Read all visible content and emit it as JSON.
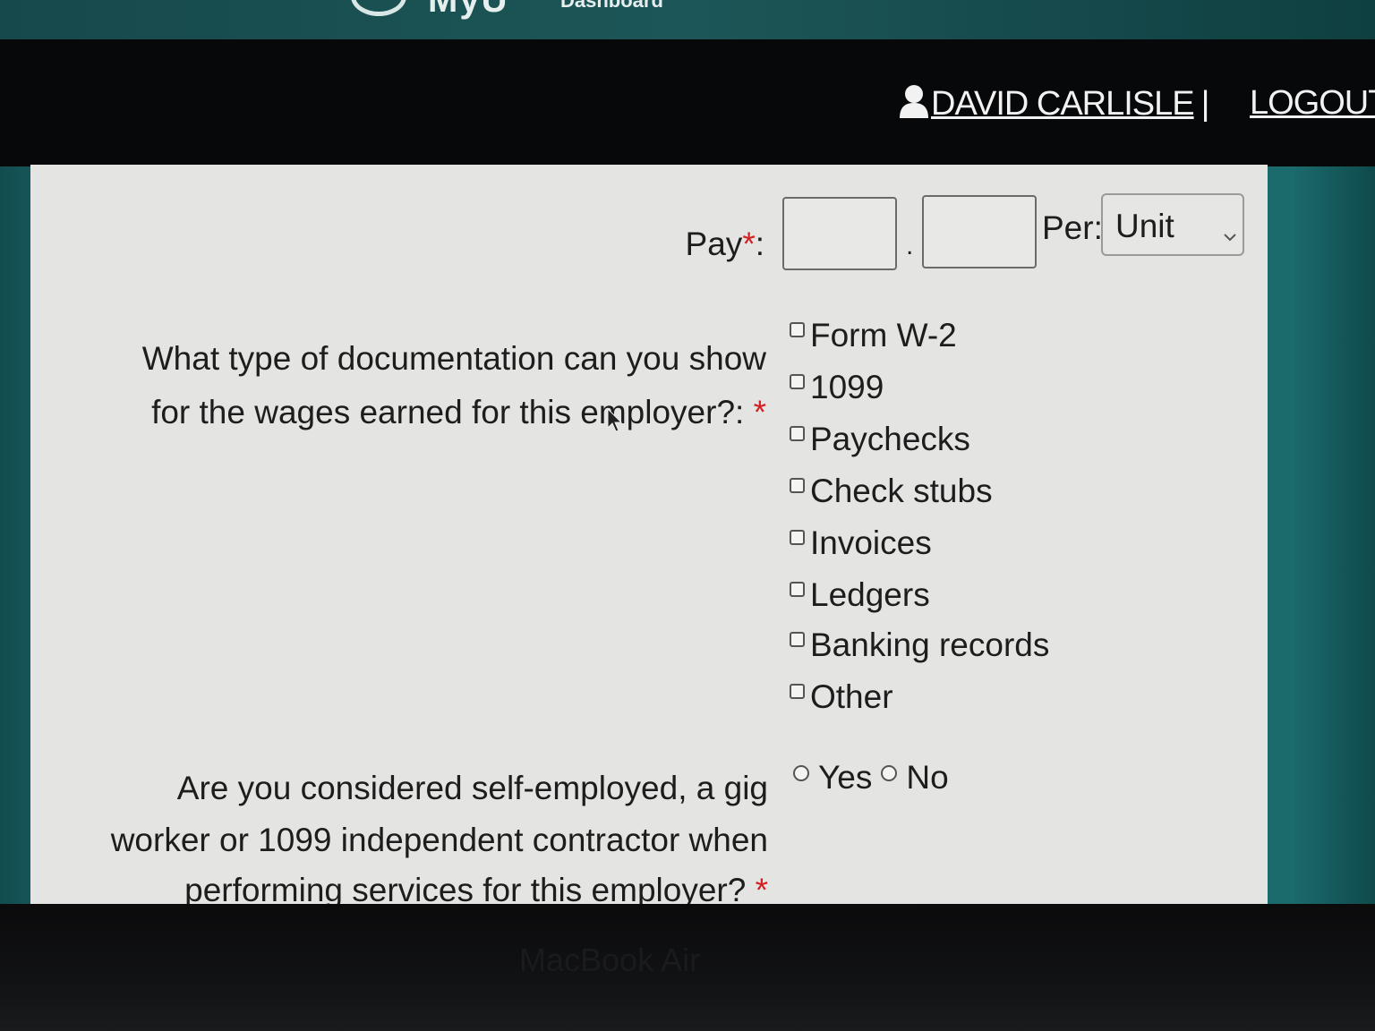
{
  "header": {
    "logo_text": "MyU",
    "logo_sub": "Dashboard",
    "user_name": "DAVID CARLISLE",
    "separator": "|",
    "logout_label": "LOGOUT"
  },
  "form": {
    "pay": {
      "label": "Pay",
      "required_mark": "*",
      "label_suffix": ":",
      "whole_value": "",
      "cents_value": "",
      "decimal_point": ".",
      "per_label": "Per:",
      "per_selected": "Unit"
    },
    "documentation": {
      "question_line1": "What type of documentation can you show",
      "question_line2": "for the wages earned for this employer?:",
      "required_mark": "*",
      "options": [
        {
          "label": "Form W-2",
          "checked": false
        },
        {
          "label": "1099",
          "checked": false
        },
        {
          "label": "Paychecks",
          "checked": false
        },
        {
          "label": "Check stubs",
          "checked": false
        },
        {
          "label": "Invoices",
          "checked": false
        },
        {
          "label": "Ledgers",
          "checked": false
        },
        {
          "label": "Banking records",
          "checked": false
        },
        {
          "label": "Other",
          "checked": false
        }
      ]
    },
    "self_employed": {
      "question_line1": "Are you considered self-employed, a gig",
      "question_line2": "worker or 1099 independent contractor when",
      "question_line3": "performing services for this employer?",
      "required_mark": "*",
      "options": [
        {
          "label": "Yes",
          "selected": false
        },
        {
          "label": "No",
          "selected": false
        }
      ]
    }
  },
  "device": {
    "bezel_label": "MacBook Air"
  },
  "colors": {
    "teal_banner": "#1d5658",
    "nav_background": "#07080a",
    "panel_background": "#e4e4e2",
    "required_red": "#d42020"
  }
}
